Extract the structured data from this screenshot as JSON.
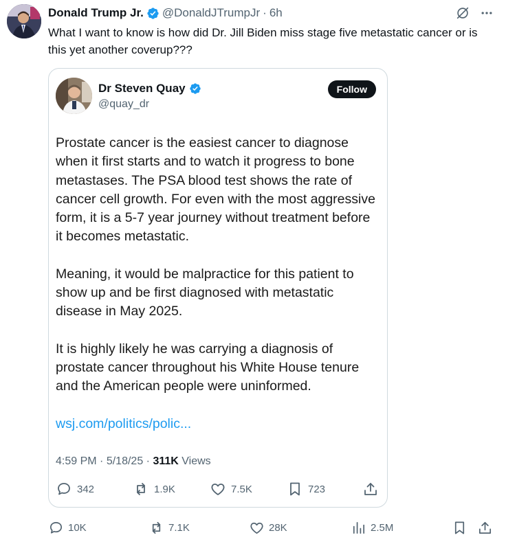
{
  "post": {
    "author_name": "Donald Trump Jr.",
    "handle": "@DonaldJTrumpJr",
    "separator": "·",
    "time": "6h",
    "text": "What I want to know is how did Dr. Jill Biden miss stage five metastatic cancer or is this yet another coverup???"
  },
  "quote": {
    "author_name": "Dr Steven Quay",
    "handle": "@quay_dr",
    "follow_label": "Follow",
    "paragraphs": [
      "Prostate cancer is the easiest cancer to diagnose when it first starts and to watch it progress to bone metastases. The PSA blood test shows the rate of cancer cell growth. For even with the most aggressive form, it is a 5-7 year journey without treatment before it becomes metastatic.",
      "Meaning, it would be malpractice for this patient to show up and be first diagnosed with metastatic disease in May 2025.",
      "It is highly likely he was carrying a diagnosis of prostate cancer throughout his White House tenure and the American people were uninformed."
    ],
    "link": "wsj.com/politics/polic...",
    "time": "4:59 PM",
    "date": "5/18/25",
    "views_count": "311K",
    "views_label": "Views",
    "replies": "342",
    "reposts": "1.9K",
    "likes": "7.5K",
    "bookmarks": "723"
  },
  "actions": {
    "replies": "10K",
    "reposts": "7.1K",
    "likes": "28K",
    "views": "2.5M"
  },
  "colors": {
    "verified": "#1d9bf0",
    "link": "#1d9bf0",
    "muted": "#536471",
    "text": "#0f1419",
    "border": "#cfd9de"
  }
}
